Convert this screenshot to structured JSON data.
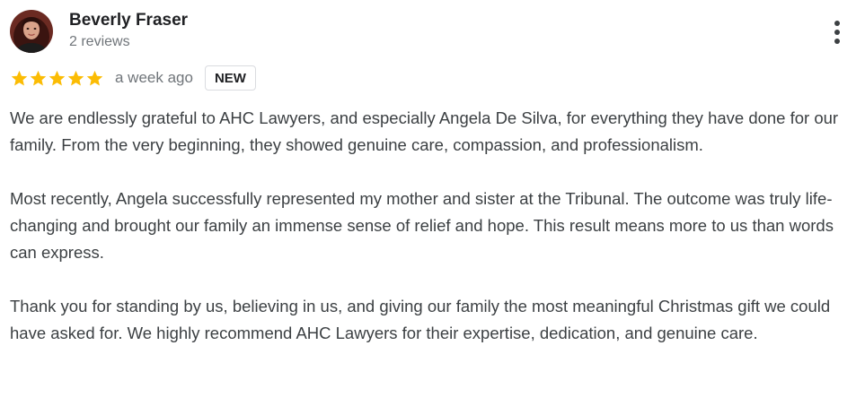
{
  "review": {
    "author": {
      "name": "Beverly Fraser",
      "review_count": "2 reviews"
    },
    "rating": {
      "stars": 5,
      "max": 5,
      "star_color": "#fbbc04"
    },
    "date": "a week ago",
    "badge": "NEW",
    "paragraphs": [
      "We are endlessly grateful to AHC Lawyers, and especially Angela De Silva, for everything they have done for our family. From the very beginning, they showed genuine care, compassion, and professionalism.",
      "Most recently, Angela successfully represented my mother and sister at the Tribunal. The outcome was truly life-changing and brought our family an immense sense of relief and hope. This result means more to us than words can express.",
      "Thank you for standing by us, believing in us, and giving our family the most meaningful Christmas gift we could have asked for. We highly recommend AHC Lawyers for their expertise, dedication, and genuine care."
    ],
    "more_icon": "more-vert-icon"
  }
}
